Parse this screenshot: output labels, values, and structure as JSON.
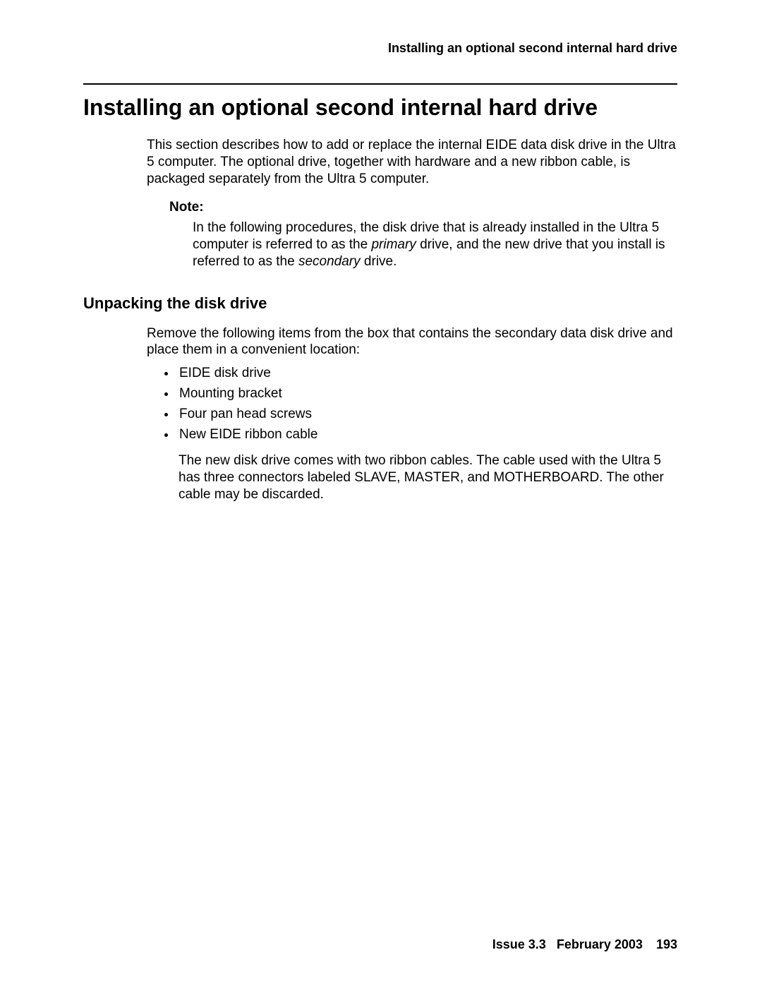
{
  "header": {
    "running_head": "Installing an optional second internal hard drive"
  },
  "title": "Installing an optional second internal hard drive",
  "intro": "This section describes how to add or replace the internal EIDE data disk drive in the Ultra 5 computer. The optional drive, together with hardware and a new ribbon cable, is packaged separately from the Ultra 5 computer.",
  "note": {
    "label": "Note:",
    "body_before": "In the following procedures, the disk drive that is already installed in the Ultra 5 computer is referred to as the ",
    "primary_word": "primary",
    "body_mid": " drive, and the new drive that you install is referred to as the ",
    "secondary_word": "secondary",
    "body_after": " drive."
  },
  "section1": {
    "heading": "Unpacking the disk drive",
    "intro": "Remove the following items from the box that contains the secondary data disk drive and place them in a convenient location:",
    "items": [
      "EIDE disk drive",
      "Mounting bracket",
      "Four pan head screws",
      "New EIDE ribbon cable"
    ],
    "cable_note": "The new disk drive comes with two ribbon cables. The cable used with the Ultra 5 has three connectors labeled SLAVE, MASTER, and MOTHERBOARD. The other cable may be discarded."
  },
  "footer": {
    "issue": "Issue 3.3",
    "date": "February 2003",
    "page": "193"
  }
}
